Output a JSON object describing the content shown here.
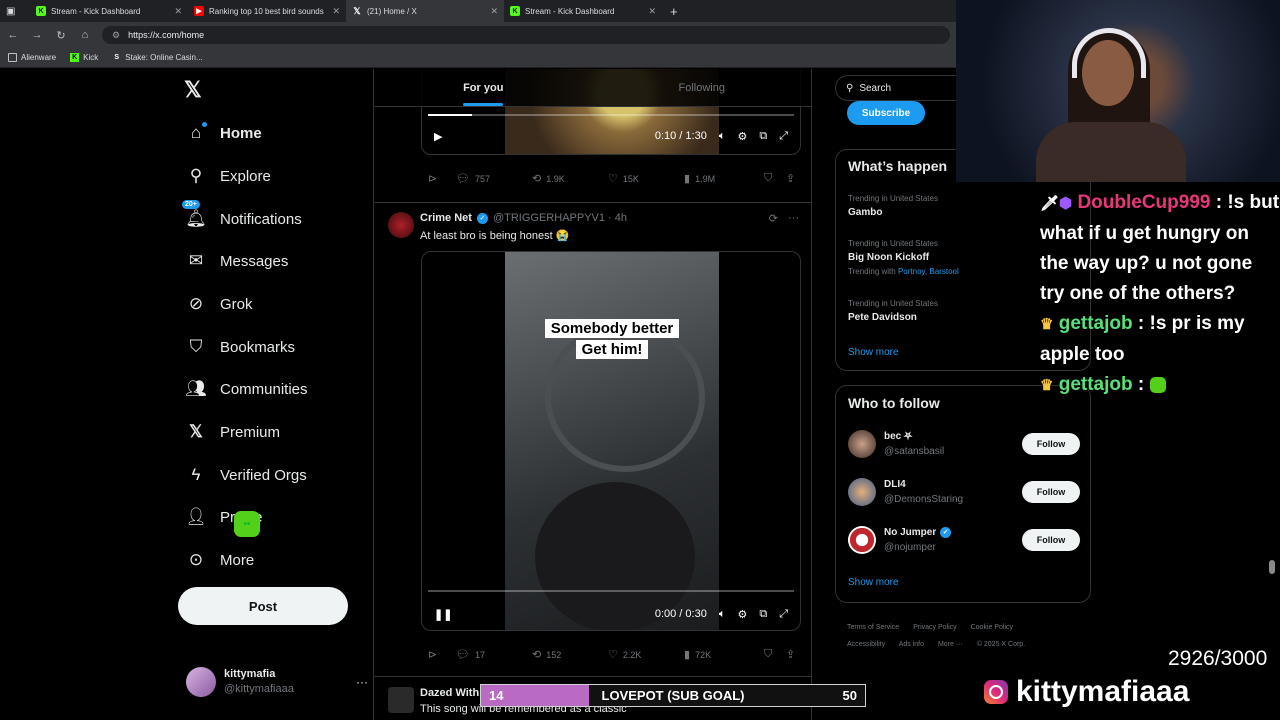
{
  "browser": {
    "tabs": [
      {
        "title": "Stream - Kick Dashboard",
        "icon": "kick-icon"
      },
      {
        "title": "Ranking top 10 best bird sounds",
        "icon": "youtube-icon"
      },
      {
        "title": "(21) Home / X",
        "icon": "x-icon"
      },
      {
        "title": "Stream - Kick Dashboard",
        "icon": "kick-icon"
      }
    ],
    "url": "https://x.com/home",
    "bookmarks": [
      "Alienware",
      "Kick",
      "Stake: Online Casin..."
    ]
  },
  "nav": {
    "items": [
      {
        "label": "Home",
        "icon": "home-icon"
      },
      {
        "label": "Explore",
        "icon": "search-icon"
      },
      {
        "label": "Notifications",
        "icon": "bell-icon",
        "badge": "20+"
      },
      {
        "label": "Messages",
        "icon": "envelope-icon"
      },
      {
        "label": "Grok",
        "icon": "grok-icon"
      },
      {
        "label": "Bookmarks",
        "icon": "bookmark-icon"
      },
      {
        "label": "Communities",
        "icon": "people-icon"
      },
      {
        "label": "Premium",
        "icon": "x-icon"
      },
      {
        "label": "Verified Orgs",
        "icon": "lightning-icon"
      },
      {
        "label": "Profile",
        "icon": "person-icon"
      },
      {
        "label": "More",
        "icon": "more-circle-icon"
      }
    ],
    "post_label": "Post",
    "user": {
      "name": "kittymafia",
      "handle": "@kittymafiaaa"
    }
  },
  "timeline": {
    "tabs": [
      "For you",
      "Following"
    ],
    "tweet1": {
      "time": "0:10 / 1:30",
      "replies": "757",
      "reposts": "1.9K",
      "likes": "15K",
      "views": "1.9M"
    },
    "tweet2": {
      "name": "Crime Net",
      "handle": "@TRIGGERHAPPYV1 · 4h",
      "text": "At least bro is being honest 😭",
      "caption_line1": "Somebody better",
      "caption_line2": "Get him!",
      "time": "0:00 / 0:30",
      "replies": "17",
      "reposts": "152",
      "likes": "2.2K",
      "views": "72K"
    },
    "tweet3": {
      "name": "Dazed With",
      "text": "This song will be remembered as a classic"
    }
  },
  "sidebar": {
    "search_placeholder": "Search",
    "subscribe_label": "Subscribe",
    "trends_title": "What’s happen",
    "trends": [
      {
        "context": "Trending in United States",
        "topic": "Gambo"
      },
      {
        "context": "Trending in United States",
        "topic": "Big Noon Kickoff",
        "with_label": "Trending with",
        "with": "Portnoy, Barstool"
      },
      {
        "context": "Trending in United States",
        "topic": "Pete Davidson"
      }
    ],
    "show_more": "Show more",
    "follow_title": "Who to follow",
    "follow": [
      {
        "name": "bec ⛧",
        "handle": "@satansbasil",
        "btn": "Follow"
      },
      {
        "name": "DLI4",
        "handle": "@DemonsStaring",
        "btn": "Follow"
      },
      {
        "name": "No Jumper",
        "handle": "@nojumper",
        "btn": "Follow"
      }
    ],
    "footer": {
      "line1": [
        "Terms of Service",
        "Privacy Policy",
        "Cookie Policy"
      ],
      "line2": [
        "Accessibility",
        "Ads info",
        "More ···",
        "© 2025 X Corp."
      ]
    }
  },
  "stream": {
    "chat": [
      {
        "user": "DoubleCup999",
        "msg": " : !s but what if u get hungry on the way up? u not gone try one of the others?"
      },
      {
        "user": "gettajob",
        "msg": " : !s pr is my apple too"
      },
      {
        "user": "gettajob",
        "msg": " : "
      }
    ],
    "sub_count": "2926/3000",
    "channel": "kittymafiaaa",
    "goal": {
      "current": "14",
      "label": "LOVEPOT (SUB GOAL)",
      "target": "50",
      "progress": 0.28
    }
  },
  "colors": {
    "accent": "#1d9bf0",
    "kick": "#53fc18",
    "goal": "#b96bc4"
  }
}
